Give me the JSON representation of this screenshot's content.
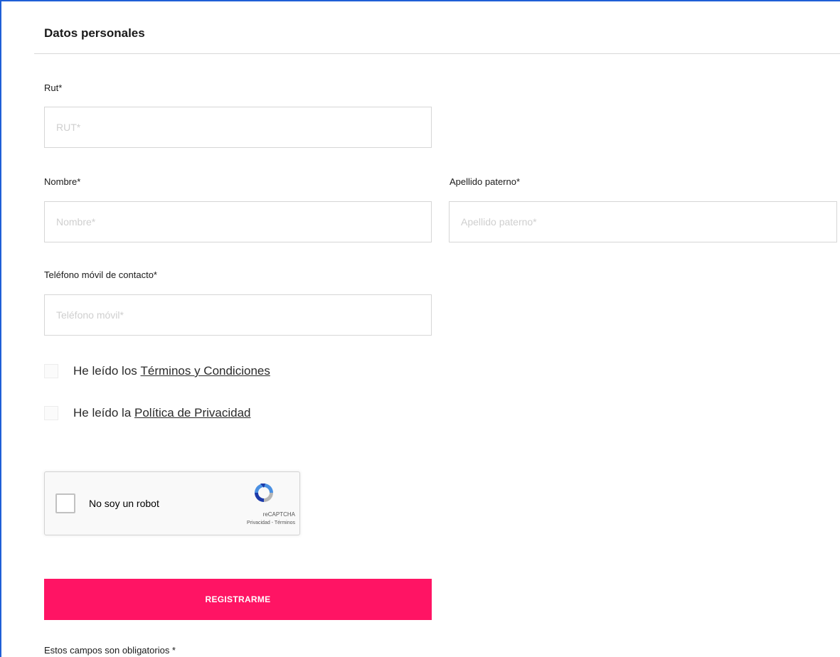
{
  "section": {
    "title": "Datos personales"
  },
  "fields": {
    "rut": {
      "label": "Rut*",
      "placeholder": "RUT*",
      "value": ""
    },
    "nombre": {
      "label": "Nombre*",
      "placeholder": "Nombre*",
      "value": ""
    },
    "apellido": {
      "label": "Apellido paterno*",
      "placeholder": "Apellido paterno*",
      "value": ""
    },
    "telefono": {
      "label": "Teléfono móvil de contacto*",
      "placeholder": "Teléfono móvil*",
      "value": ""
    }
  },
  "checkboxes": {
    "terms": {
      "prefix": "He leído los ",
      "link": "Términos y Condiciones",
      "checked": false
    },
    "privacy": {
      "prefix": "He leído la ",
      "link": "Política de Privacidad",
      "checked": false
    }
  },
  "captcha": {
    "label": "No soy un robot",
    "brand": "reCAPTCHA",
    "links": "Privacidad - Términos",
    "logo_icon": "recaptcha-logo-icon"
  },
  "submit": {
    "label": "REGISTRARME",
    "color": "#ff1464"
  },
  "footnote": "Estos campos son obligatorios *"
}
